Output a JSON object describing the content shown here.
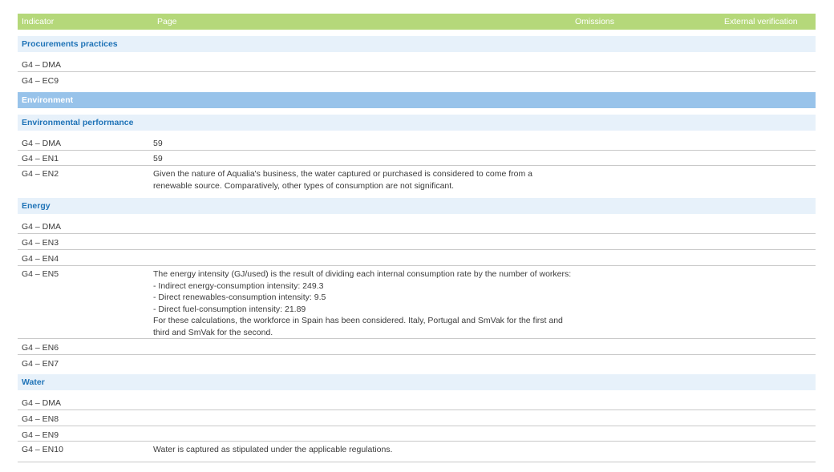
{
  "header": {
    "indicator": "Indicator",
    "page": "Page",
    "omissions": "Omissions",
    "external_verification": "External verification"
  },
  "procurement": {
    "title": "Procurements practices",
    "rows": [
      {
        "indicator": "G4 – DMA",
        "page": ""
      },
      {
        "indicator": "G4 – EC9",
        "page": ""
      }
    ]
  },
  "environment": {
    "title": "Environment",
    "performance_title": "Environmental performance",
    "performance_rows": [
      {
        "indicator": "G4 – DMA",
        "page": "59"
      },
      {
        "indicator": "G4 – EN1",
        "page": "59"
      },
      {
        "indicator": "G4 – EN2",
        "page": "Given the nature of Aqualia's business, the water captured or purchased is considered to come from a\nrenewable source. Comparatively, other types of consumption are not significant."
      }
    ],
    "energy_title": "Energy",
    "energy_rows": [
      {
        "indicator": "G4 – DMA",
        "page": ""
      },
      {
        "indicator": "G4 – EN3",
        "page": ""
      },
      {
        "indicator": "G4 – EN4",
        "page": ""
      },
      {
        "indicator": "G4 – EN5",
        "page": "The energy intensity (GJ/used) is the result of dividing each internal consumption rate by the number of workers:\n- Indirect energy-consumption intensity: 249.3\n- Direct renewables-consumption intensity: 9.5\n- Direct fuel-consumption intensity: 21.89\nFor these calculations, the workforce in Spain has been considered. Italy, Portugal and SmVak for the first and\nthird and SmVak for the second."
      },
      {
        "indicator": "G4 – EN6",
        "page": ""
      },
      {
        "indicator": "G4 – EN7",
        "page": ""
      }
    ],
    "water_title": "Water",
    "water_rows": [
      {
        "indicator": "G4 – DMA",
        "page": ""
      },
      {
        "indicator": "G4 – EN8",
        "page": ""
      },
      {
        "indicator": "G4 – EN9",
        "page": ""
      },
      {
        "indicator": "G4 – EN10",
        "page": "Water is captured as stipulated under the applicable regulations."
      }
    ]
  }
}
